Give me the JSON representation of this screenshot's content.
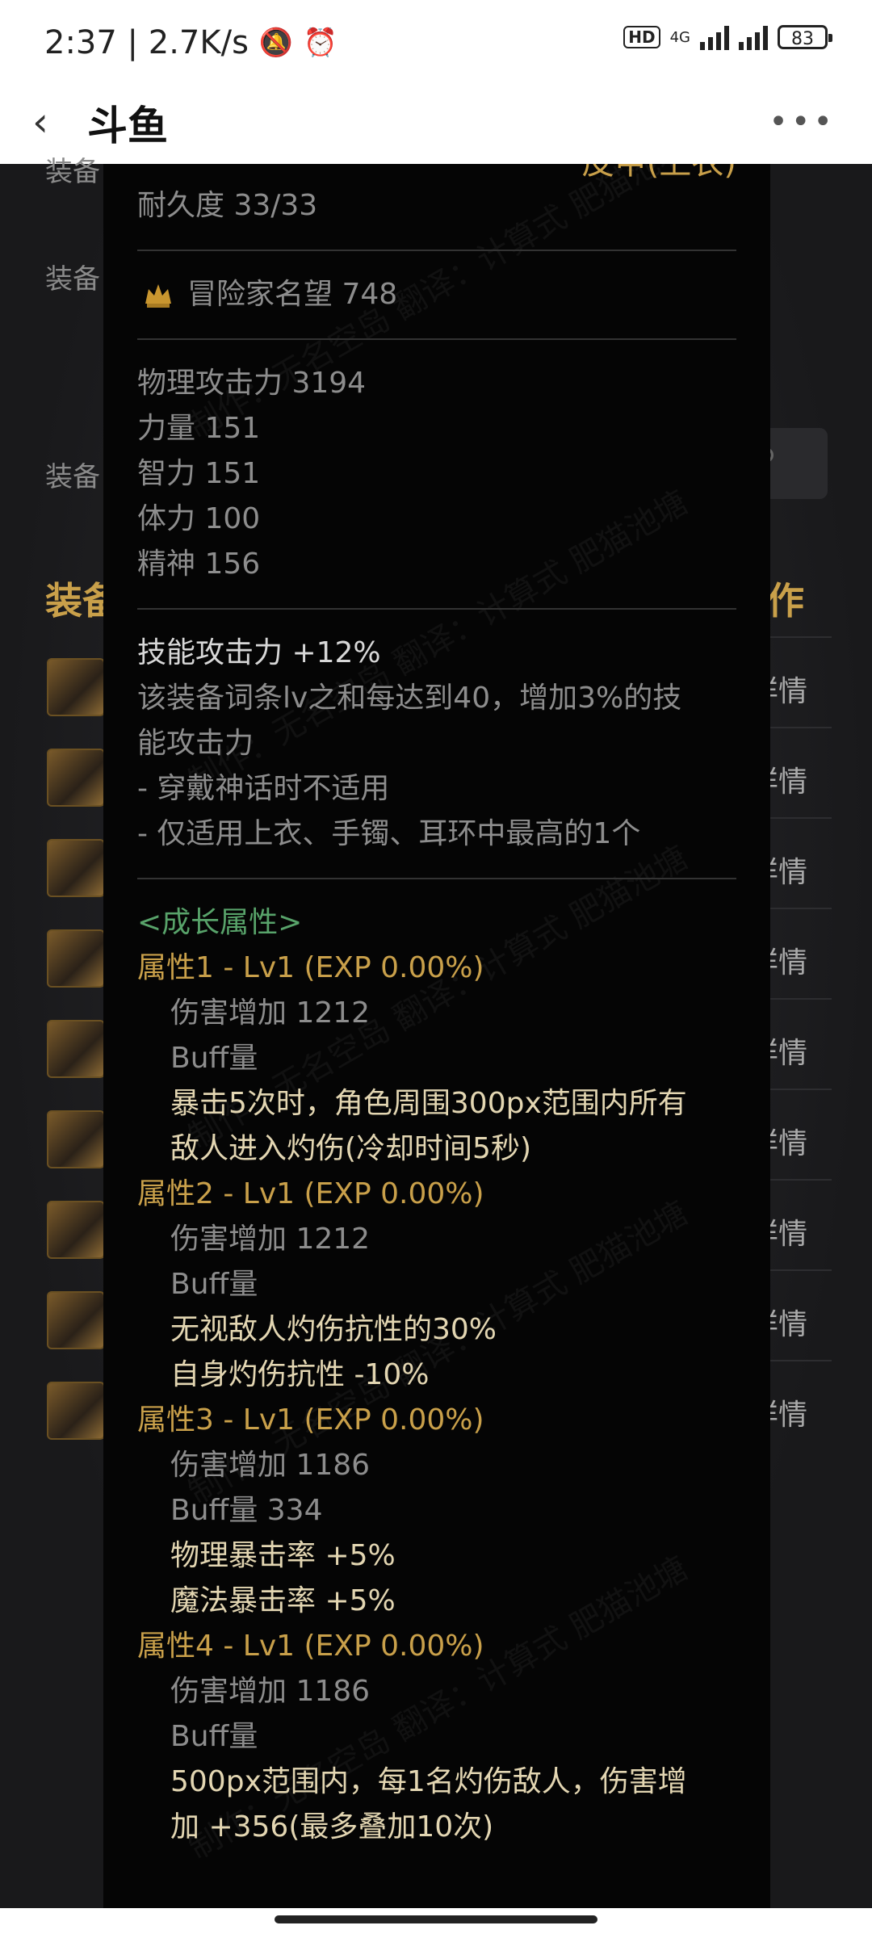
{
  "status": {
    "time": "2:37",
    "speed": "2.7K/s",
    "hd": "HD",
    "network": "4G",
    "battery": "83"
  },
  "nav": {
    "title": "斗鱼"
  },
  "background": {
    "labels": [
      "装备",
      "装备",
      "装备"
    ],
    "heading_left": "装备",
    "heading_right": "作",
    "detail_label": "详情"
  },
  "item": {
    "top_cut": "皮甲(上衣)",
    "durability": "耐久度 33/33",
    "fame": "冒险家名望 748",
    "stats": [
      {
        "name": "物理攻击力",
        "value": "3194"
      },
      {
        "name": "力量",
        "value": "151"
      },
      {
        "name": "智力",
        "value": "151"
      },
      {
        "name": "体力",
        "value": "100"
      },
      {
        "name": "精神",
        "value": "156"
      }
    ],
    "skill_attack": "技能攻击力  +12%",
    "skill_desc": [
      "该装备词条lv之和每达到40，增加3%的技",
      "能攻击力",
      "- 穿戴神话时不适用",
      "- 仅适用上衣、手镯、耳环中最高的1个"
    ],
    "growth_header": "<成长属性>",
    "growth": [
      {
        "title": "属性1 - Lv1 (EXP 0.00%)",
        "damage": "伤害增加   1212",
        "buff": "Buff量",
        "effects": [
          "暴击5次时，角色周围300px范围内所有",
          "敌人进入灼伤(冷却时间5秒)"
        ]
      },
      {
        "title": "属性2 - Lv1 (EXP 0.00%)",
        "damage": "伤害增加   1212",
        "buff": "Buff量",
        "effects": [
          "无视敌人灼伤抗性的30%",
          "自身灼伤抗性 -10%"
        ]
      },
      {
        "title": "属性3 - Lv1 (EXP 0.00%)",
        "damage": "伤害增加   1186",
        "buff": "Buff量   334",
        "effects": [
          "物理暴击率 +5%",
          "魔法暴击率 +5%"
        ]
      },
      {
        "title": "属性4 - Lv1 (EXP 0.00%)",
        "damage": "伤害增加   1186",
        "buff": "Buff量",
        "effects": [
          "500px范围内，每1名灼伤敌人，伤害增",
          "加 +356(最多叠加10次)"
        ]
      }
    ]
  }
}
